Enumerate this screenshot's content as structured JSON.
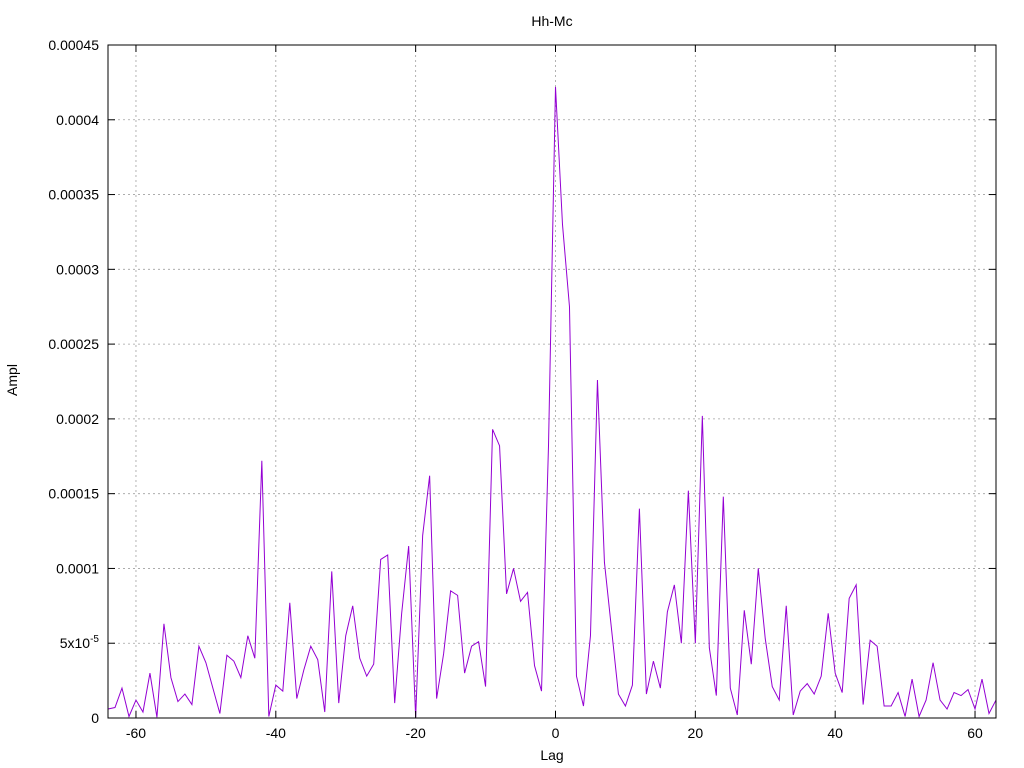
{
  "chart_data": {
    "type": "line",
    "title": "Hh-Mc",
    "xlabel": "Lag",
    "ylabel": "Ampl",
    "xlim": [
      -64,
      63
    ],
    "ylim": [
      0,
      0.00045
    ],
    "grid": true,
    "x_ticks": [
      {
        "value": -60,
        "label": "-60"
      },
      {
        "value": -40,
        "label": "-40"
      },
      {
        "value": -20,
        "label": "-20"
      },
      {
        "value": 0,
        "label": "0"
      },
      {
        "value": 20,
        "label": "20"
      },
      {
        "value": 40,
        "label": "40"
      },
      {
        "value": 60,
        "label": "60"
      }
    ],
    "y_ticks": [
      {
        "value": 0,
        "label": "0"
      },
      {
        "value": 5e-05,
        "label": "5x10",
        "exp": "-5"
      },
      {
        "value": 0.0001,
        "label": "0.0001"
      },
      {
        "value": 0.00015,
        "label": "0.00015"
      },
      {
        "value": 0.0002,
        "label": "0.0002"
      },
      {
        "value": 0.00025,
        "label": "0.00025"
      },
      {
        "value": 0.0003,
        "label": "0.0003"
      },
      {
        "value": 0.00035,
        "label": "0.00035"
      },
      {
        "value": 0.0004,
        "label": "0.0004"
      },
      {
        "value": 0.00045,
        "label": "0.00045"
      }
    ],
    "series": [
      {
        "color": "#9400d3",
        "x": [
          -64,
          -63,
          -62,
          -61,
          -60,
          -59,
          -58,
          -57,
          -56,
          -55,
          -54,
          -53,
          -52,
          -51,
          -50,
          -49,
          -48,
          -47,
          -46,
          -45,
          -44,
          -43,
          -42,
          -41,
          -40,
          -39,
          -38,
          -37,
          -36,
          -35,
          -34,
          -33,
          -32,
          -31,
          -30,
          -29,
          -28,
          -27,
          -26,
          -25,
          -24,
          -23,
          -22,
          -21,
          -20,
          -19,
          -18,
          -17,
          -16,
          -15,
          -14,
          -13,
          -12,
          -11,
          -10,
          -9,
          -8,
          -7,
          -6,
          -5,
          -4,
          -3,
          -2,
          -1,
          0,
          1,
          2,
          3,
          4,
          5,
          6,
          7,
          8,
          9,
          10,
          11,
          12,
          13,
          14,
          15,
          16,
          17,
          18,
          19,
          20,
          21,
          22,
          23,
          24,
          25,
          26,
          27,
          28,
          29,
          30,
          31,
          32,
          33,
          34,
          35,
          36,
          37,
          38,
          39,
          40,
          41,
          42,
          43,
          44,
          45,
          46,
          47,
          48,
          49,
          50,
          51,
          52,
          53,
          54,
          55,
          56,
          57,
          58,
          59,
          60,
          61,
          62,
          63
        ],
        "y": [
          6e-06,
          7e-06,
          2e-05,
          1e-06,
          1.2e-05,
          4e-06,
          3e-05,
          5e-07,
          6.3e-05,
          2.7e-05,
          1.1e-05,
          1.6e-05,
          9e-06,
          4.8e-05,
          3.7e-05,
          2e-05,
          3e-06,
          4.2e-05,
          3.8e-05,
          2.7e-05,
          5.5e-05,
          4e-05,
          0.000172,
          1e-06,
          2.2e-05,
          1.8e-05,
          7.7e-05,
          1.3e-05,
          3.2e-05,
          4.8e-05,
          3.9e-05,
          4e-06,
          9.8e-05,
          1e-05,
          5.5e-05,
          7.5e-05,
          4e-05,
          2.8e-05,
          3.6e-05,
          0.000106,
          0.000109,
          1e-05,
          7e-05,
          0.000115,
          5e-07,
          0.000122,
          0.000162,
          1.3e-05,
          4.3e-05,
          8.5e-05,
          8.2e-05,
          3e-05,
          4.8e-05,
          5.1e-05,
          2.1e-05,
          0.000193,
          0.000182,
          8.3e-05,
          0.0001,
          7.8e-05,
          8.4e-05,
          3.5e-05,
          1.8e-05,
          0.000182,
          0.000422,
          0.00033,
          0.000275,
          2.8e-05,
          8e-06,
          5.5e-05,
          0.000226,
          0.000104,
          6e-05,
          1.6e-05,
          8e-06,
          2.2e-05,
          0.00014,
          1.6e-05,
          3.8e-05,
          2e-05,
          7.1e-05,
          8.9e-05,
          5e-05,
          0.000152,
          5e-05,
          0.000202,
          4.7e-05,
          1.5e-05,
          0.000148,
          2e-05,
          2e-06,
          7.2e-05,
          3.6e-05,
          0.0001,
          5.3e-05,
          2.1e-05,
          1.2e-05,
          7.5e-05,
          2e-06,
          1.8e-05,
          2.3e-05,
          1.6e-05,
          2.8e-05,
          7e-05,
          3e-05,
          1.7e-05,
          8e-05,
          8.9e-05,
          9e-06,
          5.2e-05,
          4.8e-05,
          8e-06,
          8e-06,
          1.7e-05,
          1e-06,
          2.6e-05,
          1e-06,
          1.2e-05,
          3.7e-05,
          1.2e-05,
          6e-06,
          1.7e-05,
          1.5e-05,
          1.9e-05,
          6e-06,
          2.6e-05,
          3e-06,
          1.2e-05
        ]
      }
    ]
  }
}
